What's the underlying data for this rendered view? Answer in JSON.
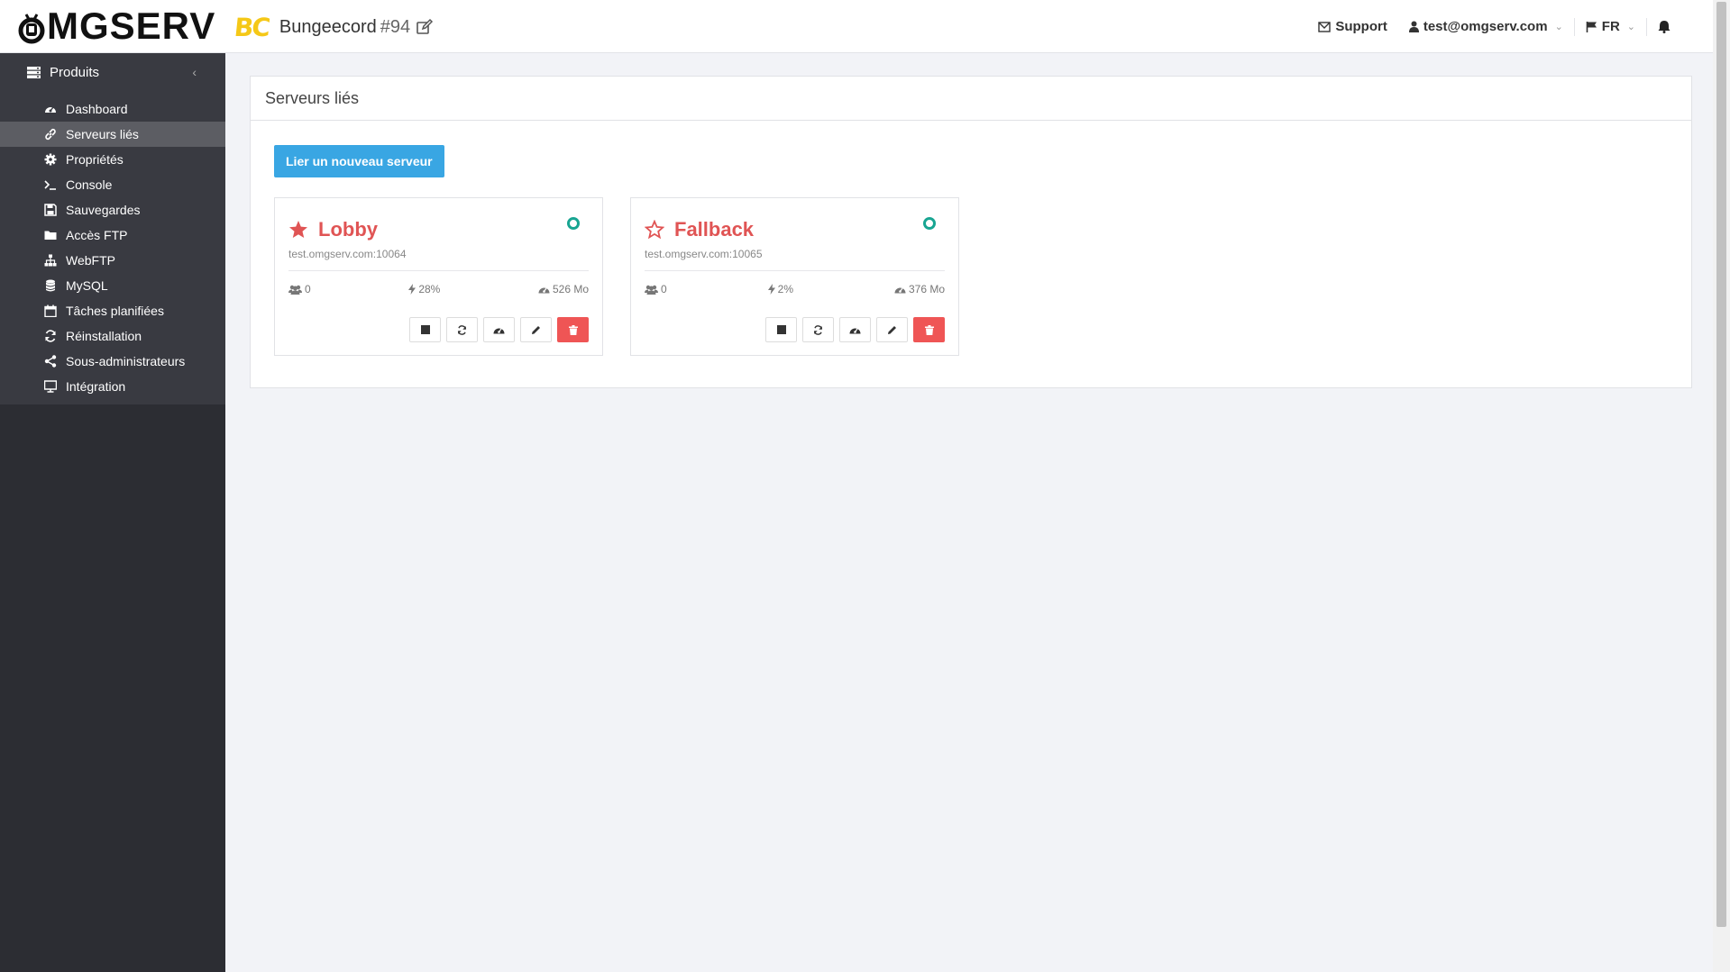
{
  "brand": {
    "logo_text": "MGSERV"
  },
  "product": {
    "badge": "BC",
    "name": "Bungeecord",
    "id": "#94"
  },
  "topbar": {
    "support_label": "Support",
    "user_email": "test@omgserv.com",
    "language": "FR"
  },
  "sidebar": {
    "section_title": "Produits",
    "items": [
      {
        "label": "Dashboard",
        "icon": "dashboard-icon"
      },
      {
        "label": "Serveurs liés",
        "icon": "link-icon",
        "active": true
      },
      {
        "label": "Propriétés",
        "icon": "gear-icon"
      },
      {
        "label": "Console",
        "icon": "terminal-icon"
      },
      {
        "label": "Sauvegardes",
        "icon": "save-icon"
      },
      {
        "label": "Accès FTP",
        "icon": "folder-icon"
      },
      {
        "label": "WebFTP",
        "icon": "sitemap-icon"
      },
      {
        "label": "MySQL",
        "icon": "database-icon"
      },
      {
        "label": "Tâches planifiées",
        "icon": "calendar-icon"
      },
      {
        "label": "Réinstallation",
        "icon": "refresh-icon"
      },
      {
        "label": "Sous-administrateurs",
        "icon": "share-icon"
      },
      {
        "label": "Intégration",
        "icon": "monitor-icon"
      }
    ]
  },
  "main": {
    "panel_title": "Serveurs liés",
    "add_button_label": "Lier un nouveau serveur",
    "servers": [
      {
        "name": "Lobby",
        "address": "test.omgserv.com:10064",
        "players": "0",
        "cpu": "28%",
        "ram": "526 Mo",
        "favorite": true
      },
      {
        "name": "Fallback",
        "address": "test.omgserv.com:10065",
        "players": "0",
        "cpu": "2%",
        "ram": "376 Mo",
        "favorite": false
      }
    ]
  },
  "colors": {
    "accent_blue": "#39a6e3",
    "server_name_red": "#e05454",
    "status_teal": "#18a592",
    "sidebar_bg": "#2c2d33",
    "badge_yellow": "#f5c817"
  }
}
